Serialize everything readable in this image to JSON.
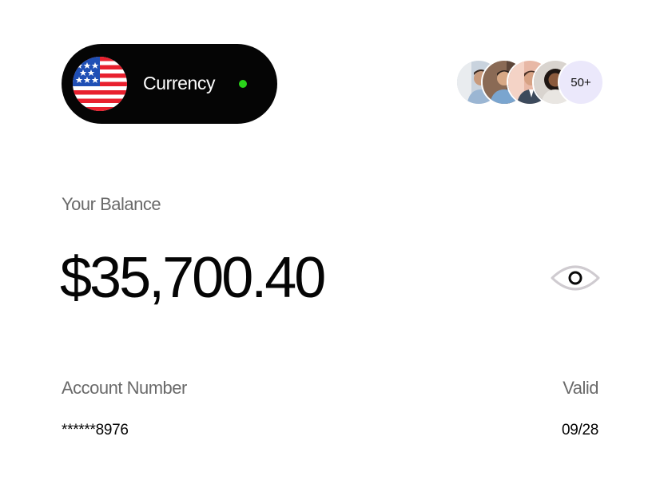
{
  "currency": {
    "label": "Currency",
    "flag_icon": "us-flag-icon",
    "status_color": "#2ad41a"
  },
  "members": {
    "avatars": [
      "avatar-1",
      "avatar-2",
      "avatar-3",
      "avatar-4"
    ],
    "more_count": "50+"
  },
  "balance": {
    "label": "Your Balance",
    "amount": "$35,700.40",
    "visibility_icon": "eye-icon"
  },
  "account": {
    "number_label": "Account Number",
    "number_value": "******8976",
    "valid_label": "Valid",
    "valid_value": "09/28"
  },
  "colors": {
    "pill_background": "#050505",
    "label_gray": "#6a6a6a",
    "badge_background": "#ebe8fb"
  }
}
